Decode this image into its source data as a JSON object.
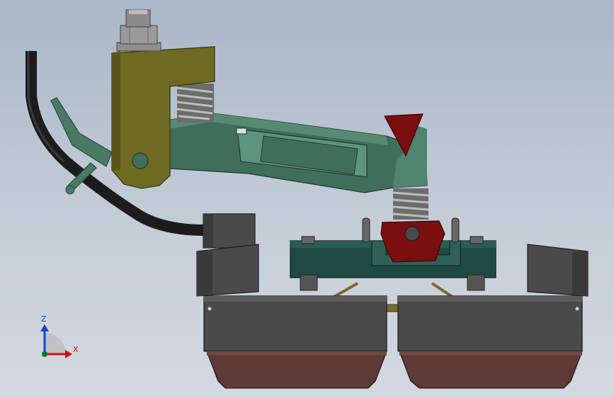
{
  "viewport": {
    "background_top": "#aab7c8",
    "background_bottom": "#d3d9e0"
  },
  "parts": {
    "cable": "#1c1c1c",
    "bracket": "#6f6a22",
    "arm": "#3f6e5a",
    "spring": "#8a8a8a",
    "nut": "#9a9a9a",
    "red_block": "#7a0f0f",
    "frame": "#1f4a42",
    "housing": "#4a4a4a",
    "shoe": "#5e3a36",
    "brace": "#7a6a2a"
  },
  "triad": {
    "z_label": "Z",
    "x_label": "X",
    "z_color": "#1a3fd0",
    "x_color": "#d01010"
  }
}
